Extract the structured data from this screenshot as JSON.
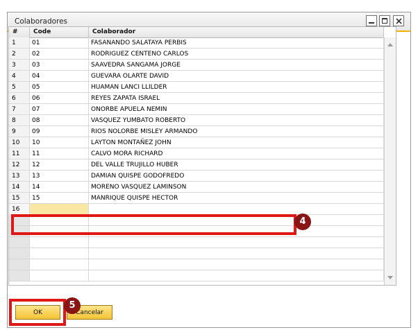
{
  "window": {
    "title": "Colaboradores"
  },
  "grid": {
    "columns": [
      "#",
      "Code",
      "Colaborador"
    ],
    "rows": [
      {
        "num": "1",
        "code": "01",
        "name": "FASANANDO SALATAYA PERBIS"
      },
      {
        "num": "2",
        "code": "02",
        "name": "RODRIGUEZ CENTENO CARLOS"
      },
      {
        "num": "3",
        "code": "03",
        "name": "SAAVEDRA SANGAMA JORGE"
      },
      {
        "num": "4",
        "code": "04",
        "name": "GUEVARA OLARTE DAVID"
      },
      {
        "num": "5",
        "code": "05",
        "name": "HUAMAN LANCI LLILDER"
      },
      {
        "num": "6",
        "code": "06",
        "name": "REYES ZAPATA ISRAEL"
      },
      {
        "num": "7",
        "code": "07",
        "name": "ONORBE APUELA NEMIN"
      },
      {
        "num": "8",
        "code": "08",
        "name": "VASQUEZ YUMBATO ROBERTO"
      },
      {
        "num": "9",
        "code": "09",
        "name": "RIOS NOLORBE MISLEY ARMANDO"
      },
      {
        "num": "10",
        "code": "10",
        "name": "LAYTON MONTAÑEZ JOHN"
      },
      {
        "num": "11",
        "code": "11",
        "name": "CALVO MORA RICHARD"
      },
      {
        "num": "12",
        "code": "12",
        "name": "DEL VALLE TRUJILLO HUBER"
      },
      {
        "num": "13",
        "code": "13",
        "name": "DAMIAN QUISPE GODOFREDO"
      },
      {
        "num": "14",
        "code": "14",
        "name": "MORENO VASQUEZ LAMINSON"
      },
      {
        "num": "15",
        "code": "15",
        "name": "MANRIQUE QUISPE HECTOR"
      },
      {
        "num": "16",
        "code": "",
        "name": ""
      }
    ]
  },
  "annotations": {
    "badge4": "4",
    "badge5": "5"
  },
  "buttons": {
    "ok": "OK",
    "cancel": "Cancelar"
  }
}
